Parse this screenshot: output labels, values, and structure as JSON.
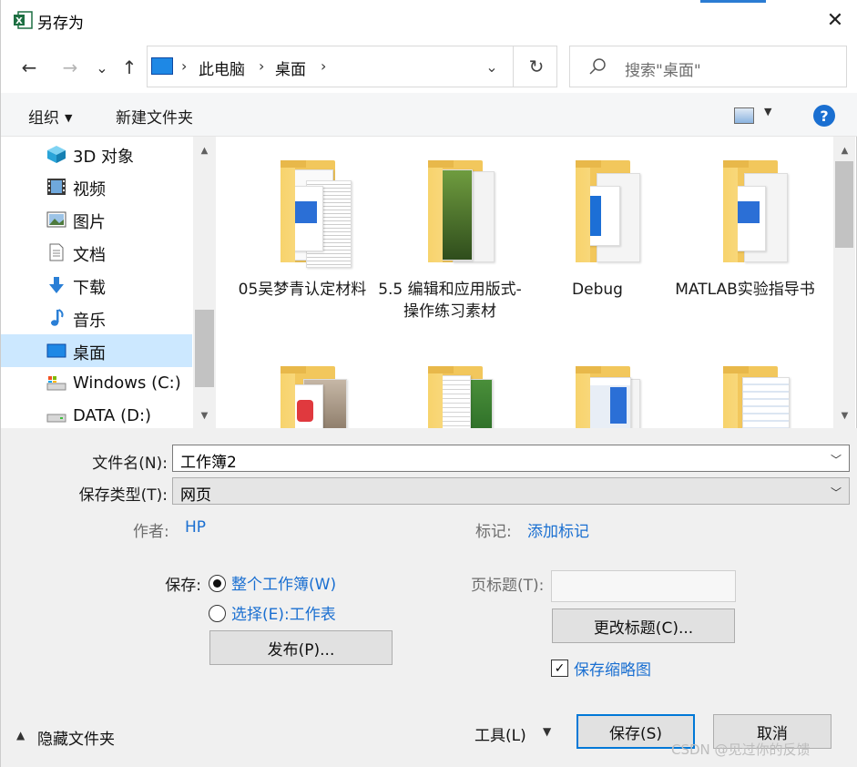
{
  "window": {
    "title": "另存为",
    "close_glyph": "✕"
  },
  "nav": {
    "back_glyph": "←",
    "forward_glyph": "→",
    "recent_glyph": "⌄",
    "up_glyph": "↑",
    "breadcrumbs": [
      "此电脑",
      "桌面"
    ],
    "refresh_glyph": "↻",
    "search_placeholder": "搜索\"桌面\""
  },
  "toolbar": {
    "organize": "组织",
    "new_folder": "新建文件夹",
    "help": "?"
  },
  "sidebar": {
    "items": [
      {
        "label": "3D 对象",
        "icon": "3d-objects-icon"
      },
      {
        "label": "视频",
        "icon": "video-icon"
      },
      {
        "label": "图片",
        "icon": "pictures-icon"
      },
      {
        "label": "文档",
        "icon": "documents-icon"
      },
      {
        "label": "下载",
        "icon": "downloads-icon"
      },
      {
        "label": "音乐",
        "icon": "music-icon"
      },
      {
        "label": "桌面",
        "icon": "desktop-icon",
        "selected": true
      },
      {
        "label": "Windows (C:)",
        "icon": "drive-icon"
      },
      {
        "label": "DATA (D:)",
        "icon": "drive-icon"
      }
    ]
  },
  "files": {
    "items": [
      {
        "label": "05吴梦青认定材料"
      },
      {
        "label": "5.5 编辑和应用版式-操作练习素材"
      },
      {
        "label": "Debug"
      },
      {
        "label": "MATLAB实验指导书"
      }
    ]
  },
  "form": {
    "filename_label": "文件名(N):",
    "filename_value": "工作簿2",
    "filetype_label": "保存类型(T):",
    "filetype_value": "网页",
    "author_label": "作者:",
    "author_value": "HP",
    "tags_label": "标记:",
    "tags_value": "添加标记",
    "save_label": "保存:",
    "radio_entire": "整个工作簿(W)",
    "radio_selection": "选择(E):工作表",
    "publish": "发布(P)...",
    "page_title_label": "页标题(T):",
    "change_title": "更改标题(C)...",
    "thumbnail": "保存缩略图"
  },
  "footer": {
    "hide_folders": "隐藏文件夹",
    "tools": "工具(L)",
    "save": "保存(S)",
    "cancel": "取消"
  },
  "watermark": "CSDN @见过你的反馈"
}
